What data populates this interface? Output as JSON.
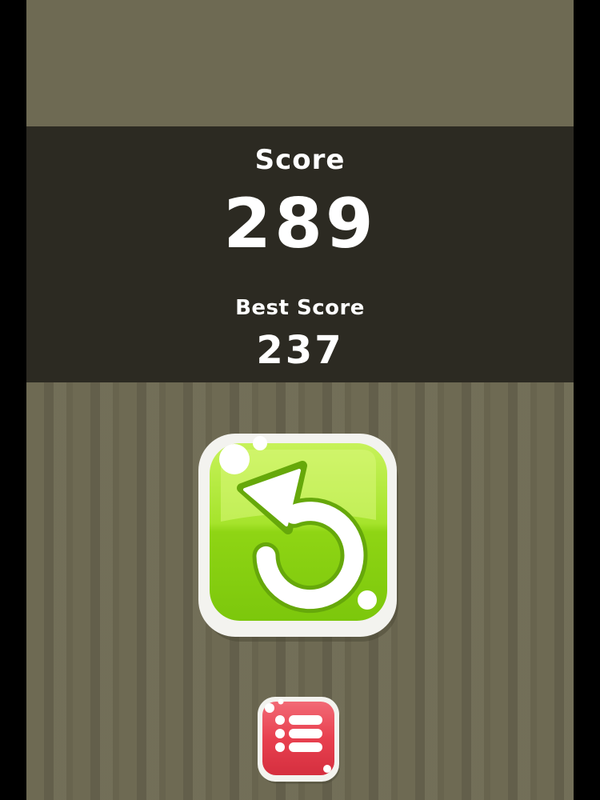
{
  "score": {
    "label": "Score",
    "value": "289"
  },
  "best_score": {
    "label": "Best Score",
    "value": "237"
  },
  "buttons": {
    "replay": {
      "icon": "replay-icon",
      "color": "#8fd816"
    },
    "menu": {
      "icon": "list-icon",
      "color": "#e8404f"
    }
  },
  "colors": {
    "background": "#6e6a53",
    "panel": "#2c2a22",
    "side_bars": "#000000",
    "text": "#ffffff"
  }
}
